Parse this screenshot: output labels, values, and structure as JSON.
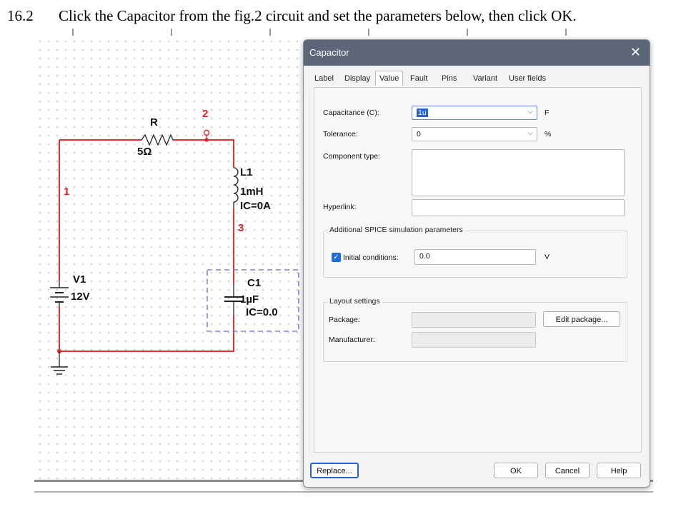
{
  "instruction": {
    "number": "16.2",
    "text": "Click the Capacitor from the fig.2 circuit and set the parameters below, then click OK."
  },
  "circuit": {
    "resistor": {
      "name": "R",
      "value": "5Ω"
    },
    "inductor": {
      "name": "L1",
      "value": "1mH",
      "ic": "IC=0A"
    },
    "capacitor": {
      "name": "C1",
      "value": "1µF",
      "ic": "IC=0.0"
    },
    "source": {
      "name": "V1",
      "value": "12V"
    },
    "nodes": {
      "n1": "1",
      "n2": "2",
      "n3": "3"
    },
    "colors": {
      "wire": "#e03030",
      "selection": "#8080e0",
      "node_label": "#e02020"
    }
  },
  "dialog": {
    "title": "Capacitor",
    "close_icon": "close-icon",
    "tabs": [
      {
        "label": "Label",
        "active": false
      },
      {
        "label": "Display",
        "active": false
      },
      {
        "label": "Value",
        "active": true
      },
      {
        "label": "Fault",
        "active": false
      },
      {
        "label": "Pins",
        "active": false
      },
      {
        "label": "Variant",
        "active": false
      },
      {
        "label": "User fields",
        "active": false
      }
    ],
    "capacitance": {
      "label": "Capacitance (C):",
      "value": "1u",
      "unit": "F"
    },
    "tolerance": {
      "label": "Tolerance:",
      "value": "0",
      "unit": "%"
    },
    "component_type": {
      "label": "Component type:",
      "value": ""
    },
    "hyperlink": {
      "label": "Hyperlink:",
      "value": ""
    },
    "spice_group": {
      "title": "Additional SPICE simulation parameters",
      "initial_conditions": {
        "label": "Initial conditions:",
        "checked": true,
        "value": "0.0",
        "unit": "V"
      }
    },
    "layout_group": {
      "title": "Layout settings",
      "package_label": "Package:",
      "manufacturer_label": "Manufacturer:",
      "edit_package_button": "Edit package..."
    },
    "buttons": {
      "replace": "Replace...",
      "ok": "OK",
      "cancel": "Cancel",
      "help": "Help"
    },
    "colors": {
      "titlebar": "#5b6778",
      "accent": "#2a62c8"
    }
  }
}
